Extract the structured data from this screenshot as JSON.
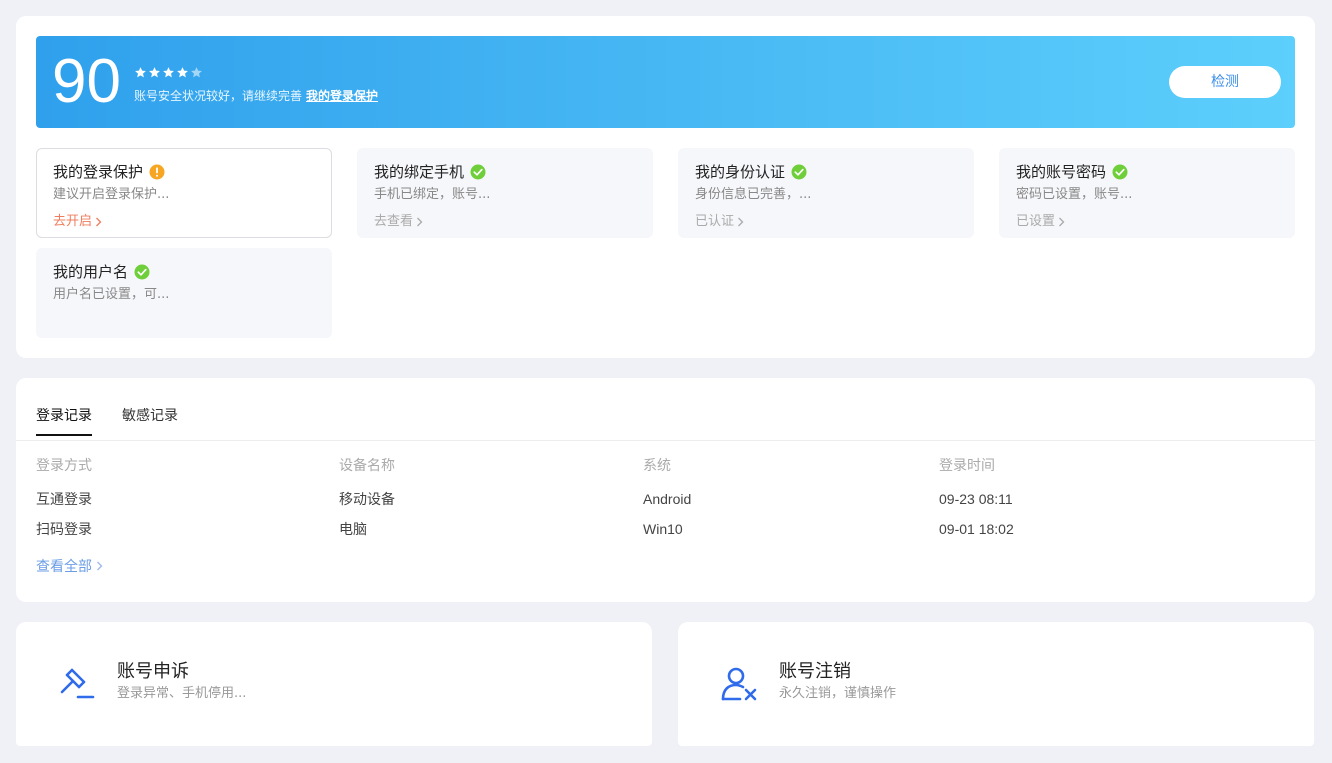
{
  "security": {
    "score": "90",
    "stars_filled": 4,
    "stars_total": 5,
    "status_text": "账号安全状况较好，请继续完善",
    "status_link": "我的登录保护",
    "check_button": "检测",
    "colors": {
      "banner_start": "#2fa0ec",
      "banner_end": "#5ccffc",
      "ok": "#6fcf3a",
      "warn": "#f6a623"
    },
    "items": [
      {
        "title": "我的登录保护",
        "status": "warning",
        "desc": "建议开启登录保护...",
        "action": "去开启"
      },
      {
        "title": "我的绑定手机",
        "status": "ok",
        "desc": "手机已绑定，账号...",
        "action": "去查看"
      },
      {
        "title": "我的身份认证",
        "status": "ok",
        "desc": "身份信息已完善，...",
        "action": "已认证"
      },
      {
        "title": "我的账号密码",
        "status": "ok",
        "desc": "密码已设置，账号...",
        "action": "已设置"
      },
      {
        "title": "我的用户名",
        "status": "ok",
        "desc": "用户名已设置，可...",
        "action": ""
      }
    ]
  },
  "records": {
    "tabs": [
      "登录记录",
      "敏感记录"
    ],
    "active_tab": 0,
    "columns": [
      "登录方式",
      "设备名称",
      "系统",
      "登录时间"
    ],
    "rows": [
      [
        "互通登录",
        "移动设备",
        "Android",
        "09-23 08:11"
      ],
      [
        "扫码登录",
        "电脑",
        "Win10",
        "09-01 18:02"
      ]
    ],
    "view_all": "查看全部"
  },
  "actions": {
    "appeal": {
      "title": "账号申诉",
      "desc": "登录异常、手机停用...",
      "icon": "gavel-icon"
    },
    "cancel": {
      "title": "账号注销",
      "desc": "永久注销，谨慎操作",
      "icon": "user-remove-icon"
    }
  }
}
